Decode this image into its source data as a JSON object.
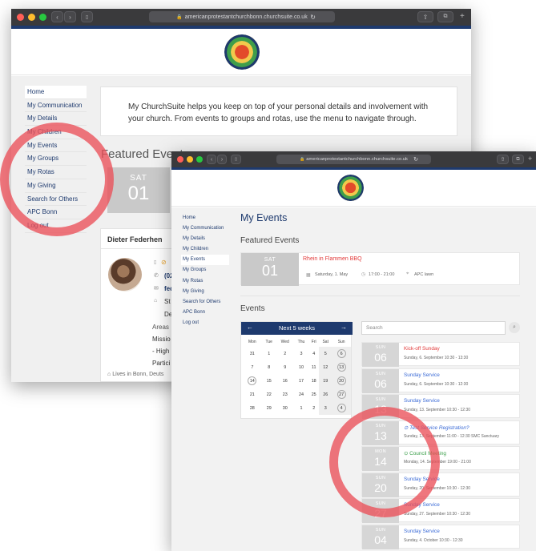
{
  "colors": {
    "navy": "#1e3a6e",
    "red_link": "#e23a3a",
    "blue_link": "#3a6ad6",
    "green_link": "#3a9e48",
    "ring": "#ea5058"
  },
  "back_window": {
    "url": "americanprotestantchurchbonn.churchsuite.co.uk",
    "nav": [
      "Home",
      "My Communication",
      "My Details",
      "My Children",
      "My Events",
      "My Groups",
      "My Rotas",
      "My Giving",
      "Search for Others",
      "APC Bonn",
      "Log out"
    ],
    "welcome": "My ChurchSuite helps you keep on top of your personal details and involvement with your church. From events to groups and rotas, use the menu to navigate through.",
    "featured_heading": "Featured Event",
    "featured_day": "SAT",
    "featured_num": "01",
    "profile": {
      "name": "Dieter Federhen",
      "lines": [
        "(02",
        "fed",
        "St",
        "De",
        "Areas",
        "Missio",
        "- High",
        "Partici"
      ],
      "lives_in": "Lives in Bonn, Deuts"
    }
  },
  "front_window": {
    "url": "americanprotestantchurchbonn.churchsuite.co.uk",
    "nav": [
      "Home",
      "My Communication",
      "My Details",
      "My Children",
      "My Events",
      "My Groups",
      "My Rotas",
      "My Giving",
      "Search for Others",
      "APC Bonn",
      "Log out"
    ],
    "page_title": "My Events",
    "featured_heading": "Featured Events",
    "featured": {
      "day": "SAT",
      "num": "01",
      "title": "Rhein in Flammen BBQ",
      "date": "Saturday, 1. May",
      "time": "17:00 - 21:00",
      "location": "APC lawn"
    },
    "events_heading": "Events",
    "calendar": {
      "header": "Next 5 weeks",
      "prev": "←",
      "next": "→",
      "weekdays": [
        "Mon",
        "Tue",
        "Wed",
        "Thu",
        "Fri",
        "Sat",
        "Sun"
      ],
      "weeks": [
        [
          "31",
          "1",
          "2",
          "3",
          "4",
          "5",
          "6"
        ],
        [
          "7",
          "8",
          "9",
          "10",
          "11",
          "12",
          "13"
        ],
        [
          "14",
          "15",
          "16",
          "17",
          "18",
          "19",
          "20"
        ],
        [
          "21",
          "22",
          "23",
          "24",
          "25",
          "26",
          "27"
        ],
        [
          "28",
          "29",
          "30",
          "1",
          "2",
          "3",
          "4"
        ]
      ]
    },
    "search_placeholder": "Search",
    "events": [
      {
        "day": "SUN",
        "num": "06",
        "title": "Kick-off Sunday",
        "sub": "Sunday, 6. September   10:30 - 13:30",
        "color": "#e23a3a"
      },
      {
        "day": "SUN",
        "num": "06",
        "title": "Sunday Service",
        "sub": "Sunday, 6. September   10:30 - 12:30",
        "color": "#3a6ad6"
      },
      {
        "day": "SUN",
        "num": "13",
        "title": "Sunday Service",
        "sub": "Sunday, 13. September   10:30 - 12:30",
        "color": "#3a6ad6"
      },
      {
        "day": "SUN",
        "num": "13",
        "title": "Test Service Registration?",
        "sub": "Sunday, 13. September   11:00 - 12:30   SMC Sanctuary",
        "color": "#3a6ad6"
      },
      {
        "day": "MON",
        "num": "14",
        "title": "Council Meeting",
        "sub": "Monday, 14. September   19:00 - 21:00",
        "color": "#3a9e48"
      },
      {
        "day": "SUN",
        "num": "20",
        "title": "Sunday Service",
        "sub": "Sunday, 20. September   10:30 - 12:30",
        "color": "#3a6ad6"
      },
      {
        "day": "SUN",
        "num": "27",
        "title": "Sunday Service",
        "sub": "Sunday, 27. September   10:30 - 12:30",
        "color": "#3a6ad6"
      },
      {
        "day": "SUN",
        "num": "04",
        "title": "Sunday Service",
        "sub": "Sunday, 4. October   10:30 - 12:30",
        "color": "#3a6ad6"
      }
    ]
  }
}
